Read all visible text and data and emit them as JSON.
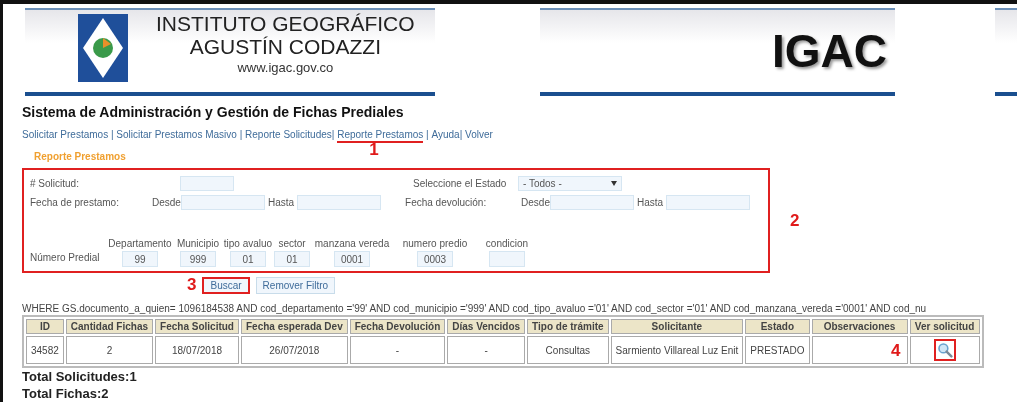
{
  "header": {
    "institution_line1": "INSTITUTO GEOGRÁFICO",
    "institution_line2": "AGUSTÍN CODAZZI",
    "website": "www.igac.gov.co",
    "acronym": "IGAC"
  },
  "system_title": "Sistema de Administración y Gestión de Fichas Prediales",
  "nav": [
    {
      "label": "Solicitar Prestamos",
      "separator": " | "
    },
    {
      "label": "Solicitar Prestamos Masivo",
      "separator": " | "
    },
    {
      "label": "Reporte Solicitudes",
      "separator": "| "
    },
    {
      "label": "Reporte Prestamos",
      "separator": " | ",
      "annotation": "1"
    },
    {
      "label": "Ayuda",
      "separator": "| "
    },
    {
      "label": "Volver"
    }
  ],
  "section_title": "Reporte Prestamos",
  "filters": {
    "annotation": "2",
    "solicitud_label": "# Solicitud:",
    "estado_label": "Seleccione el Estado",
    "estado_value": "- Todos -",
    "fecha_prestamo": {
      "label": "Fecha de prestamo:",
      "from_label": "Desde",
      "to_label": "Hasta"
    },
    "fecha_devolucion": {
      "label": "Fecha devolución:",
      "from_label": "Desde",
      "to_label": "Hasta"
    },
    "numero_predial": {
      "label": "Número Predial",
      "fields": [
        {
          "label": "Departamento",
          "value": "99"
        },
        {
          "label": "Municipio",
          "value": "999"
        },
        {
          "label": "tipo avaluo",
          "value": "01"
        },
        {
          "label": "sector",
          "value": "01"
        },
        {
          "label": "manzana vereda",
          "value": "0001"
        },
        {
          "label": "numero predio",
          "value": "0003"
        },
        {
          "label": "condicion"
        }
      ]
    }
  },
  "buttons": [
    {
      "label": "Buscar",
      "annotation": "3"
    },
    {
      "label": "Remover Filtro"
    }
  ],
  "query_text": "WHERE GS.documento_a_quien= 1096184538 AND cod_departamento ='99' AND cod_municipio ='999' AND cod_tipo_avaluo ='01' AND cod_sector ='01' AND cod_manzana_vereda ='0001' AND cod_nu",
  "table": {
    "columns": [
      "ID",
      "Cantidad Fichas",
      "Fecha Solicitud",
      "Fecha esperada Dev",
      "Fecha Devolución",
      "Días Vencidos",
      "Tipo de trámite",
      "Solicitante",
      "Estado",
      "Observaciones",
      "Ver solicitud"
    ],
    "rows": [
      {
        "annotation": "4",
        "cells": [
          "34582",
          "2",
          "18/07/2018",
          "26/07/2018",
          "-",
          "-",
          "Consultas",
          "Sarmiento Villareal Luz Enit",
          "PRESTADO",
          null,
          null
        ]
      }
    ]
  },
  "totals": [
    "Total Solicitudes:1",
    "Total Fichas:2"
  ]
}
